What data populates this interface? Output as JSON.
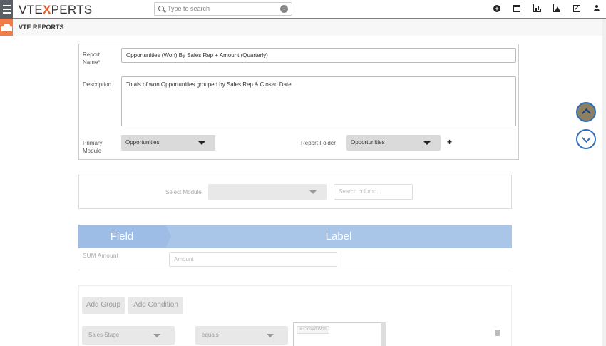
{
  "topbar": {
    "logo_prefix": "VTE",
    "logo_x": "X",
    "logo_suffix": "PERTS",
    "search_placeholder": "Type to search",
    "icons": [
      "plus-circle-icon",
      "calendar-icon",
      "bar-chart-icon",
      "area-chart-icon",
      "task-check-icon",
      "user-icon"
    ]
  },
  "subbar": {
    "title": "VTE REPORTS"
  },
  "form": {
    "report_name_label_line1": "Report",
    "report_name_label_line2": "Name*",
    "report_name_value": "Opportunities (Won) By Sales Rep + Amount (Quarterly)",
    "description_label": "Description",
    "description_value": "Totals of won Opportunities grouped by Sales Rep & Closed Date",
    "primary_module_label_line1": "Primary",
    "primary_module_label_line2": "Module",
    "primary_module_value": "Opportunities",
    "report_folder_label": "Report Folder",
    "report_folder_value": "Opportunities",
    "add_folder_label": "+"
  },
  "columns": {
    "select_module_label": "Select Module",
    "select_module_value": "",
    "search_placeholder": "Search column..."
  },
  "fields": {
    "header_field": "Field",
    "header_label": "Label",
    "rows": [
      {
        "field": "SUM Amount",
        "label_placeholder": "Amount"
      }
    ]
  },
  "conditions": {
    "add_group": "Add Group",
    "add_condition": "Add Condition",
    "field_value": "Sales Stage",
    "operator_value": "equals",
    "tag_remove": "×",
    "tag_value": "Closed Won"
  },
  "colors": {
    "accent": "#e65c2e",
    "header_blue": "#a9c5e8",
    "nav_blue": "#2e6fb8"
  }
}
